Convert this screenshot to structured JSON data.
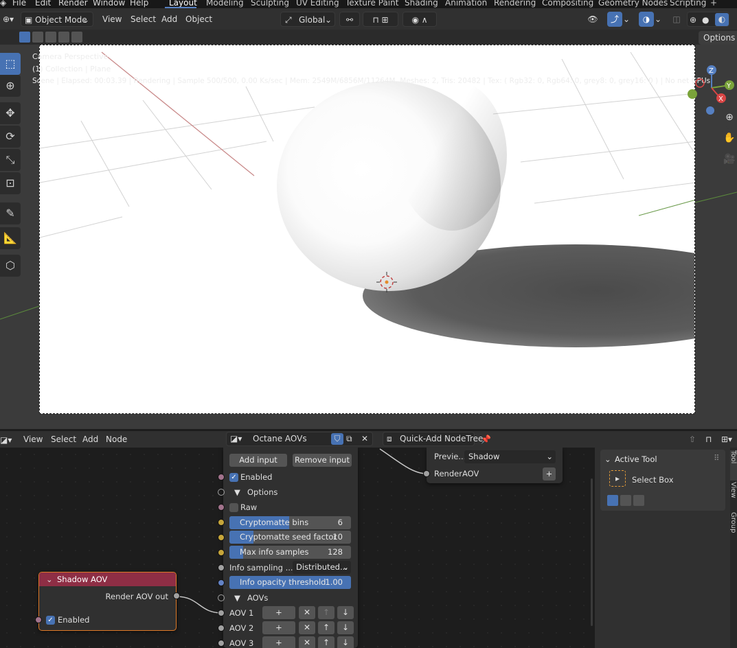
{
  "menu": {
    "file": "File",
    "edit": "Edit",
    "render": "Render",
    "window": "Window",
    "help": "Help",
    "workspaces": [
      "Layout",
      "Modeling",
      "Sculpting",
      "UV Editing",
      "Texture Paint",
      "Shading",
      "Animation",
      "Rendering",
      "Compositing",
      "Geometry Nodes",
      "Scripting"
    ],
    "add_workspace": "+"
  },
  "viewport_header": {
    "mode": "Object Mode",
    "view": "View",
    "select": "Select",
    "add": "Add",
    "object": "Object",
    "orientation": "Global",
    "options": "Options"
  },
  "overlay": {
    "line1": "Camera Perspective",
    "line2": "(1) Collection | Plane",
    "line3": "Scene | Elapsed: 00:03.39 |    Rendering | Sample 500/500, 0.00 Ks/sec | Mem: 2549M/6856M/11264M, Meshes: 2, Tris: 20482 | Tex: ( Rgb32: 0, Rgb64: 0, grey8: 0, grey16: 0 ) | No net GPUs"
  },
  "gizmo": {
    "z": "Z",
    "y": "Y",
    "x": "X"
  },
  "node_header": {
    "view": "View",
    "select": "Select",
    "add": "Add",
    "node": "Node",
    "tree_name": "Octane AOVs",
    "quick_add": "Quick-Add NodeTree"
  },
  "shadow_node": {
    "title": "Shadow AOV",
    "output": "Render AOV out",
    "enabled": "Enabled",
    "colors": {
      "header": "#8e2e45",
      "border": "#e07a27"
    }
  },
  "aov_node": {
    "add_input": "Add input",
    "remove_input": "Remove input",
    "enabled": "Enabled",
    "options": "Options",
    "raw": "Raw",
    "crypto_bins": {
      "label": "Cryptomatte bins",
      "value": "6",
      "fill": 0.55
    },
    "crypto_seed": {
      "label": "Cryptomatte seed factor",
      "value": "10",
      "fill": 0.2
    },
    "max_info": {
      "label": "Max info samples",
      "value": "128",
      "fill": 0.15
    },
    "info_sampling": {
      "label": "Info sampling ...",
      "value": "Distributed..."
    },
    "info_opacity": {
      "label": "Info opacity threshold",
      "value": "1.00",
      "fill": 1.0
    },
    "aovs": "AOVs",
    "aov_rows": [
      "AOV 1",
      "AOV 2",
      "AOV 3"
    ]
  },
  "preview_node": {
    "label": "Previe...",
    "value": "Shadow",
    "output": "RenderAOV",
    "plus": "+"
  },
  "sidebar": {
    "active_tool": "Active Tool",
    "select_box": "Select Box",
    "tabs": [
      "Tool",
      "View",
      "Group"
    ]
  },
  "colors": {
    "accent": "#4772b3",
    "socket_purple": "#a2738c",
    "socket_yellow": "#c7a63a",
    "socket_grey": "#a1a1a1",
    "socket_blue": "#6383c6"
  }
}
